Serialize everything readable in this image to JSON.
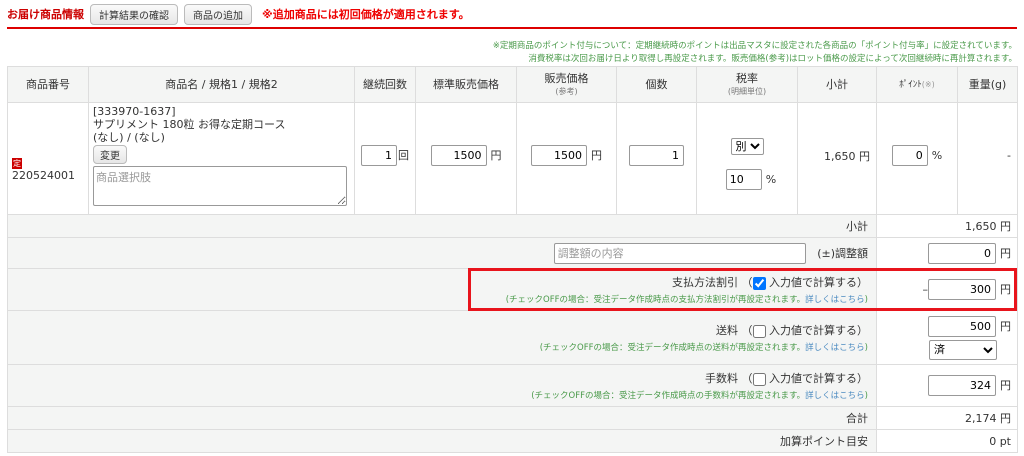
{
  "header": {
    "title": "お届け商品情報",
    "confirm_button": "計算結果の確認",
    "add_button": "商品の追加",
    "warning": "※追加商品には初回価格が適用されます。"
  },
  "notes": [
    "※定期商品のポイント付与について：定期継続時のポイントは出品マスタに設定された各商品の「ポイント付与率」に設定されています。",
    "消費税率は次回お届け日より取得し再設定されます。販売価格(参考)はロット価格の設定によって次回継続時に再計算されます。"
  ],
  "columns": {
    "code": "商品番号",
    "name": "商品名 / 規格1 / 規格2",
    "count": "継続回数",
    "std_price": "標準販売価格",
    "price": "販売価格",
    "price_sub": "(参考)",
    "qty": "個数",
    "tax": "税率",
    "tax_sub": "(明細単位)",
    "subtotal": "小計",
    "point": "ﾎﾟｲﾝﾄ",
    "point_sub": "(※)",
    "weight": "重量(g)"
  },
  "item": {
    "badge": "定",
    "code": "220524001",
    "sku": "[333970-1637]",
    "name": "サプリメント 180粒 お得な定期コース",
    "spec": "(なし) / (なし)",
    "change_button": "変更",
    "option_placeholder": "商品選択肢",
    "count": "1",
    "count_unit": "回",
    "std_price": "1500",
    "price": "1500",
    "yen": "円",
    "qty": "1",
    "tax_type": "別",
    "tax_rate": "10",
    "percent": "%",
    "subtotal": "1,650 円",
    "point": "0",
    "weight": "-"
  },
  "summary": {
    "subtotal_label": "小計",
    "subtotal_value": "1,650 円",
    "adjust_placeholder": "調整額の内容",
    "adjust_label": "(±)調整額",
    "adjust_value": "0",
    "payment_label": "支払方法割引",
    "payment_check": "入力値で計算する",
    "payment_note": "(チェックOFFの場合：受注データ作成時点の支払方法割引が再設定されます。",
    "payment_minus": "–",
    "payment_value": "300",
    "shipping_label": "送料",
    "shipping_check": "入力値で計算する",
    "shipping_note": "(チェックOFFの場合：受注データ作成時点の送料が再設定されます。",
    "shipping_value": "500",
    "shipping_status": "済",
    "fee_label": "手数料",
    "fee_check": "入力値で計算する",
    "fee_note": "(チェックOFFの場合：受注データ作成時点の手数料が再設定されます。",
    "fee_value": "324",
    "detail_link": "詳しくはこちら",
    "open_paren": "（",
    "close_paren": "）",
    "close_paren_small": ")",
    "total_label": "合計",
    "total_value": "2,174 円",
    "points_label": "加算ポイント目安",
    "points_value": "0 pt",
    "yen": "円"
  }
}
